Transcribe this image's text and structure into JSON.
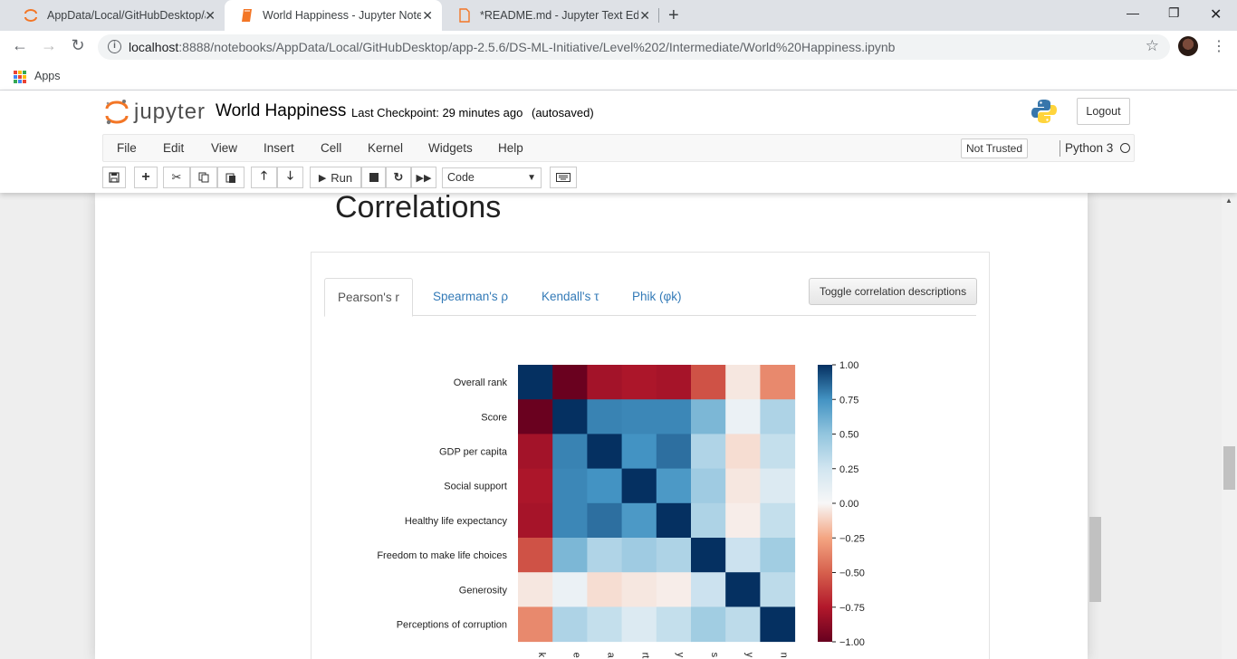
{
  "browser": {
    "tabs": [
      {
        "title": "AppData/Local/GitHubDesktop/a",
        "icon": "jupyter-icon",
        "active": false
      },
      {
        "title": "World Happiness - Jupyter Noteb",
        "icon": "notebook-icon",
        "active": true
      },
      {
        "title": "*README.md - Jupyter Text Edito",
        "icon": "file-icon",
        "active": false
      }
    ],
    "url_host": "localhost",
    "url_rest": ":8888/notebooks/AppData/Local/GitHubDesktop/app-2.5.6/DS-ML-Initiative/Level%202/Intermediate/World%20Happiness.ipynb",
    "bookmark_apps": "Apps"
  },
  "jupyter": {
    "logo_text": "jupyter",
    "notebook_name": "World Happiness",
    "checkpoint": "Last Checkpoint: 29 minutes ago",
    "autosave": "(autosaved)",
    "logout": "Logout",
    "menu": [
      "File",
      "Edit",
      "View",
      "Insert",
      "Cell",
      "Kernel",
      "Widgets",
      "Help"
    ],
    "trust": "Not Trusted",
    "kernel": "Python 3",
    "run_label": "Run",
    "cell_type": "Code"
  },
  "notebook": {
    "heading": "Correlations",
    "tabs": [
      "Pearson's r",
      "Spearman's ρ",
      "Kendall's τ",
      "Phik (φk)"
    ],
    "toggle_button": "Toggle correlation descriptions"
  },
  "chart_data": {
    "type": "heatmap",
    "title": "",
    "rows": [
      "Overall rank",
      "Score",
      "GDP per capita",
      "Social support",
      "Healthy life expectancy",
      "Freedom to make life choices",
      "Generosity",
      "Perceptions of corruption"
    ],
    "columns": [
      "Overall rank",
      "Score",
      "GDP per capita",
      "Social support",
      "Healthy life expectancy",
      "Freedom to make life choices",
      "Generosity",
      "Perceptions of corruption"
    ],
    "values": [
      [
        1.0,
        -0.99,
        -0.8,
        -0.77,
        -0.79,
        -0.55,
        -0.05,
        -0.35
      ],
      [
        -0.99,
        1.0,
        0.79,
        0.78,
        0.78,
        0.57,
        0.08,
        0.39
      ],
      [
        -0.8,
        0.79,
        1.0,
        0.75,
        0.84,
        0.38,
        -0.08,
        0.3
      ],
      [
        -0.77,
        0.78,
        0.75,
        1.0,
        0.72,
        0.45,
        -0.05,
        0.18
      ],
      [
        -0.79,
        0.78,
        0.84,
        0.72,
        1.0,
        0.39,
        -0.03,
        0.3
      ],
      [
        -0.55,
        0.57,
        0.38,
        0.45,
        0.39,
        1.0,
        0.27,
        0.44
      ],
      [
        -0.05,
        0.08,
        -0.08,
        -0.05,
        -0.03,
        0.27,
        1.0,
        0.33
      ],
      [
        -0.35,
        0.39,
        0.3,
        0.18,
        0.3,
        0.44,
        0.33,
        1.0
      ]
    ],
    "x_tick_labels_visible": [
      "k",
      "e",
      "a",
      "rt",
      "y",
      "s",
      "y",
      "n"
    ],
    "colorbar_ticks": [
      "1.00",
      "0.75",
      "0.50",
      "0.25",
      "0.00",
      "−0.25",
      "−0.50",
      "−0.75",
      "−1.00"
    ],
    "colorbar_range": [
      -1,
      1
    ],
    "colormap": "RdBu"
  }
}
